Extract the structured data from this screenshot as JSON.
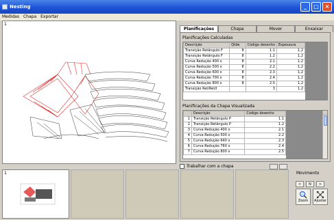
{
  "window": {
    "title": "Nesting"
  },
  "menu": [
    "Medidas",
    "Chapa",
    "Exportar"
  ],
  "canvas": {
    "sheet_number": "1"
  },
  "tabs": [
    "Planificações",
    "Chapa",
    "Mover",
    "Enxaixar"
  ],
  "planificacoes": {
    "label": "Planificações Calculadas",
    "columns": [
      "Descrição",
      "Qtde",
      "Código desenho",
      "Espessura"
    ],
    "rows": [
      [
        "Transição Retângulo F",
        "8",
        "1.1",
        "1,2"
      ],
      [
        "Transição Retângulo F",
        "8",
        "1.2",
        "1,2"
      ],
      [
        "Curva Redução 400 x",
        "8",
        "2.1",
        "1,2"
      ],
      [
        "Curva Redução 500 x",
        "8",
        "2.2",
        "1,2"
      ],
      [
        "Curva Redução 600 x",
        "8",
        "2.3",
        "1,2"
      ],
      [
        "Curva Redução 700 x",
        "8",
        "2.4",
        "1,2"
      ],
      [
        "Curva Redução 800 x",
        "8",
        "2.5",
        "1,2"
      ],
      [
        "Transição Ret/Ret/I",
        "",
        "3",
        "1,2"
      ]
    ]
  },
  "chapa": {
    "label": "Planificações da Chapa Visualizada",
    "columns": [
      "",
      "Descrição",
      "Código desenho"
    ],
    "rows": [
      [
        "1",
        "Transição Retângulo P",
        "1.1"
      ],
      [
        "2",
        "Transição Retângulo P",
        "1.2"
      ],
      [
        "3",
        "Curva Redução 400 x",
        "2.1"
      ],
      [
        "4",
        "Curva Redução 500 x",
        "2.2"
      ],
      [
        "5",
        "Curva Redução 640 x",
        "2.3"
      ],
      [
        "6",
        "Curva Redução 760 x",
        "2.4"
      ],
      [
        "7",
        "Curva Redução 800 x",
        "2.5"
      ]
    ]
  },
  "checkbox": {
    "label": "Trabalhar com a chapa"
  },
  "thumbnails": {
    "first_number": "1"
  },
  "movimento": {
    "title": "Movimento",
    "buttons": [
      "<",
      "N",
      ">"
    ],
    "zoom_label": "Zoom",
    "ajustar_label": "Ajustar"
  },
  "colors": {
    "titlebar": "#1d54d8",
    "highlight_parts": "#e03030",
    "grid_fill": "#8a8a8a"
  }
}
